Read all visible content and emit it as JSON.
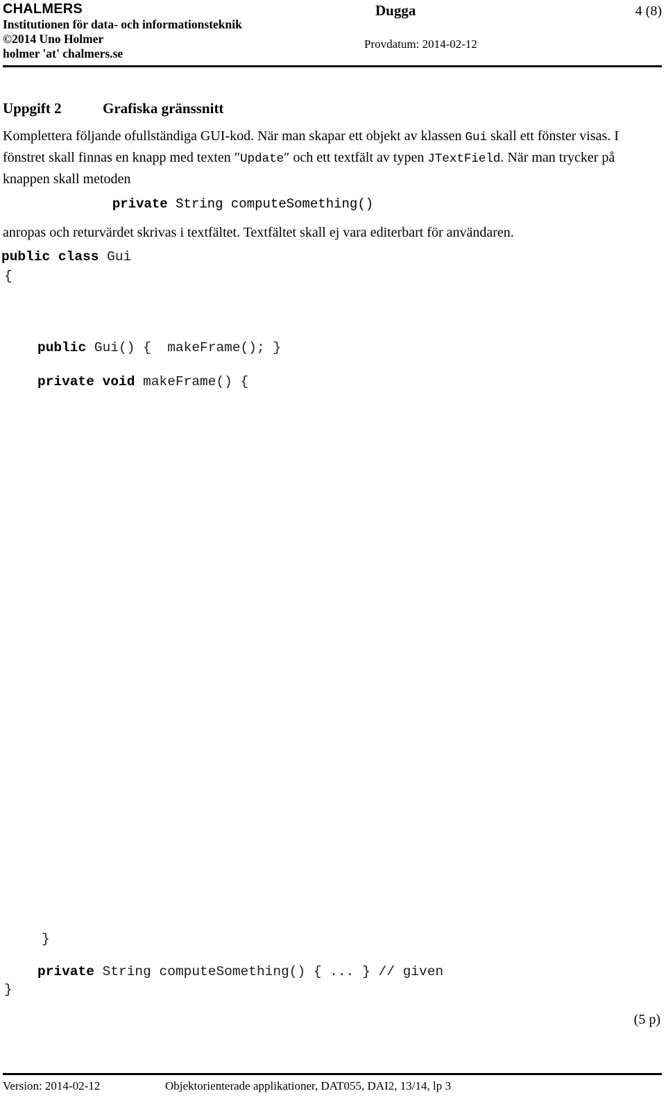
{
  "header": {
    "org": "CHALMERS",
    "department": "Institutionen för data- och informationsteknik",
    "copyright": "©2014 Uno Holmer",
    "email": "holmer 'at' chalmers.se",
    "doc_title": "Dugga",
    "page_number": "4 (8)",
    "exam_date_label": "Provdatum: 2014-02-12"
  },
  "task": {
    "number": "Uppgift 2",
    "title": "Grafiska gränssnitt",
    "paragraph_1_a": "Komplettera följande ofullständiga GUI-kod. När man skapar ett objekt av klassen ",
    "paragraph_1_code_1": "Gui",
    "paragraph_1_b": " skall ett fönster visas. I fönstret skall finnas en knapp med texten ",
    "paragraph_1_quote_open": "″",
    "paragraph_1_code_2": "Update",
    "paragraph_1_quote_close": "″",
    "paragraph_1_c": " och ett textfält av typen ",
    "paragraph_1_code_3": "JTextField",
    "paragraph_1_d": ". När man trycker på knappen skall metoden",
    "signature_bold": "private",
    "signature_rest": " String computeSomething()",
    "paragraph_2": "anropas och returvärdet skrivas i textfältet. Textfältet skall ej vara editerbart för användaren.",
    "points": "(5 p)"
  },
  "code": {
    "class_decl_bold": "public class",
    "class_decl_rest": " Gui",
    "brace_open": "{",
    "ctor_bold": "public",
    "ctor_rest": " Gui() {  makeFrame(); }",
    "makeframe_bold": "private void",
    "makeframe_rest": " makeFrame() {",
    "brace_close_inner": "}",
    "compute_bold": "private",
    "compute_rest": " String computeSomething() { ... } // given",
    "brace_close_outer": "}"
  },
  "footer": {
    "version": "Version: 2014-02-12",
    "course": "Objektorienterade applikationer, DAT055, DAI2, 13/14, lp 3"
  }
}
